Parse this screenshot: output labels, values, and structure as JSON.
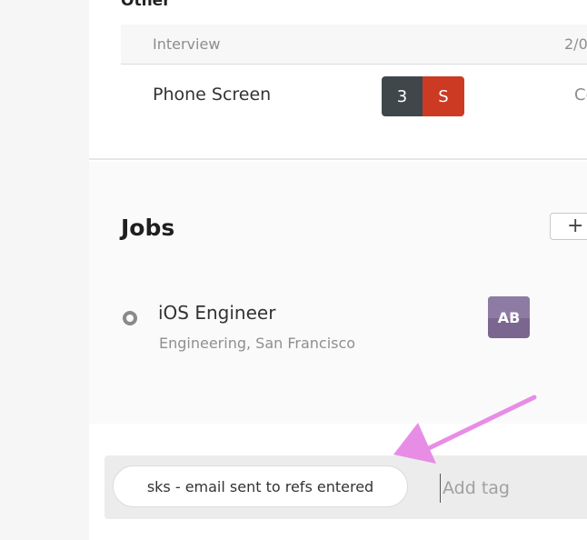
{
  "other_section": {
    "heading": "Other",
    "table_header": {
      "interview": "Interview",
      "date": "2/0"
    },
    "row": {
      "label": "Phone Screen",
      "score_number": "3",
      "score_letter": "S",
      "status": "Co"
    }
  },
  "jobs": {
    "title": "Jobs",
    "add_button_label": "+",
    "items": [
      {
        "title": "iOS Engineer",
        "subtitle": "Engineering, San Francisco",
        "avatar_initials": "AB"
      }
    ]
  },
  "tags": {
    "items": [
      {
        "label": "sks - email sent to refs entered"
      }
    ],
    "add_placeholder": "Add tag"
  },
  "annotation": {
    "arrow_color": "#e88de6"
  },
  "colors": {
    "score_dark": "#40474b",
    "score_red": "#cc3a24",
    "avatar_purple": "#7a668f"
  }
}
